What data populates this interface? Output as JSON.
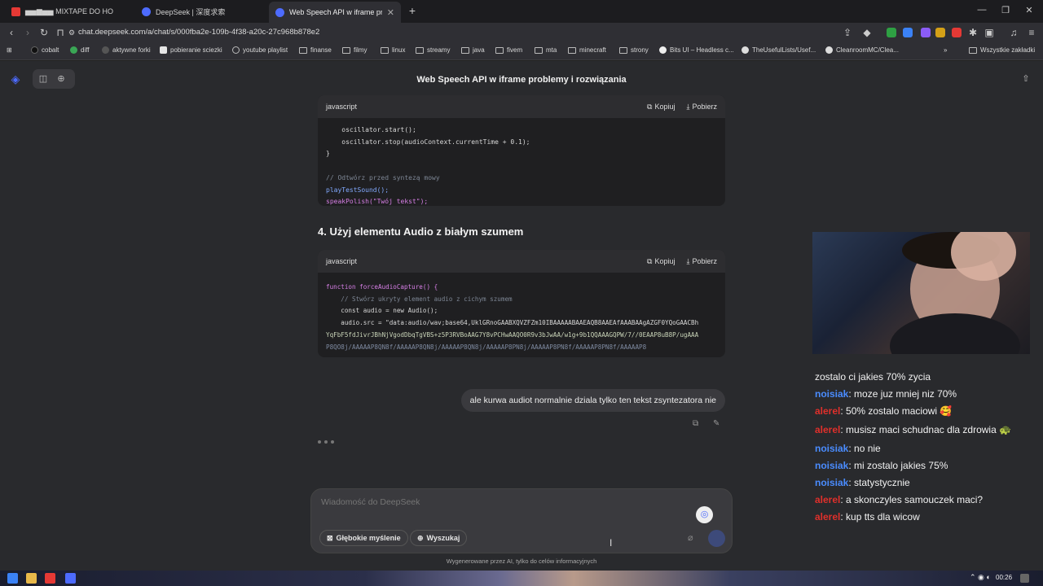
{
  "tabs": [
    {
      "label": "▅▅▆▅▅ MIXTAPE DO HO",
      "favicon_color": "#e53935"
    },
    {
      "label": "DeepSeek | 深度求索",
      "favicon_color": "#4d6bfe"
    },
    {
      "label": "Web Speech API w iframe proble",
      "favicon_color": "#4d6bfe",
      "active": true
    }
  ],
  "address_bar": {
    "url": "chat.deepseek.com/a/chat/s/000fba2e-109b-4f38-a20c-27c968b878e2"
  },
  "bookmarks": [
    {
      "label": "cobalt",
      "icon": "cobalt-icon"
    },
    {
      "label": "diff",
      "icon": "diff-icon"
    },
    {
      "label": "aktywne forki",
      "icon": "fork-icon"
    },
    {
      "label": "pobieranie sciezki",
      "icon": "download-icon"
    },
    {
      "label": "youtube playlist",
      "icon": "globe-icon"
    },
    {
      "label": "finanse",
      "icon": "folder-icon"
    },
    {
      "label": "filmy",
      "icon": "folder-icon"
    },
    {
      "label": "linux",
      "icon": "folder-icon"
    },
    {
      "label": "streamy",
      "icon": "folder-icon"
    },
    {
      "label": "java",
      "icon": "folder-icon"
    },
    {
      "label": "fivem",
      "icon": "folder-icon"
    },
    {
      "label": "mta",
      "icon": "folder-icon"
    },
    {
      "label": "minecraft",
      "icon": "folder-icon"
    },
    {
      "label": "strony",
      "icon": "folder-icon"
    },
    {
      "label": "Bits UI – Headless c...",
      "icon": "circle-icon"
    },
    {
      "label": "TheUsefulLists/Usef...",
      "icon": "github-icon"
    },
    {
      "label": "CleanroomMC/Clea...",
      "icon": "github-icon"
    },
    {
      "label": "Wszystkie zakładki",
      "icon": "folder-icon"
    }
  ],
  "chat": {
    "title": "Web Speech API w iframe problemy i rozwiązania",
    "code_actions": {
      "copy": "Kopiuj",
      "download": "Pobierz"
    },
    "block1": {
      "lang": "javascript",
      "lines": [
        "    oscillator.start();",
        "    oscillator.stop(audioContext.currentTime + 0.1);",
        "}",
        "",
        "// Odtwórz przed syntezą mowy",
        "playTestSound();",
        "speakPolish(\"Twój tekst\");"
      ]
    },
    "section4": "4. Użyj elementu Audio z białym szumem",
    "block2": {
      "lang": "javascript",
      "lines": [
        "function forceAudioCapture() {",
        "    // Stwórz ukryty element audio z cichym szumem",
        "    const audio = new Audio();",
        "    audio.src = \"data:audio/wav;base64,UklGRnoGAABXQVZFZm10IBAAAAABAAEAQB8AAEAfAAABAAgAZGF0YQoGAACBh",
        "YqFbF5fdJivrJBhNjVgodDbqTgVBS+z5P3RVBoAAG7Y8vPCHwAAQO0R9v3bJwAA/w1g+9b1QQAAAGQPW/7//0EAAP8uB8P/ugAAA",
        "P8QO8j/AAAAAP8QN8f/AAAAAP8QN8j/AAAAAP8QN8j/AAAAAP8PN8j/AAAAAP8PN8f/AAAAAP8PN8f/AAAAAP8"
      ]
    },
    "user_message": "ale kurwa audiot normalnie dziala tylko ten tekst zsyntezatora nie",
    "composer_placeholder": "Wiadomość do DeepSeek",
    "deep_think_label": "Głębokie myślenie",
    "search_label": "Wyszukaj",
    "footer_note": "Wygenerowane przez AI, tylko do celów informacyjnych"
  },
  "stream_chat": [
    {
      "nick": "",
      "text": "zostalo ci jakies 70% zycia",
      "color": "#f2f2f2"
    },
    {
      "nick": "noisiak",
      "text": ": moze juz mniej niz 70%",
      "color": "#4a8cff"
    },
    {
      "nick": "alerel",
      "text": ": 50% zostalo maciowi 🥰",
      "color": "#e0302b"
    },
    {
      "nick": "alerel",
      "text": ": musisz maci schudnac dla zdrowia 🐢",
      "color": "#e0302b"
    },
    {
      "nick": "noisiak",
      "text": ": no nie",
      "color": "#4a8cff"
    },
    {
      "nick": "noisiak",
      "text": ": mi zostalo jakies 75%",
      "color": "#4a8cff"
    },
    {
      "nick": "noisiak",
      "text": ": statystycznie",
      "color": "#4a8cff"
    },
    {
      "nick": "alerel",
      "text": ": a skonczyles samouczek maci?",
      "color": "#e0302b"
    },
    {
      "nick": "alerel",
      "text": ": kup tts dla wicow",
      "color": "#e0302b"
    }
  ],
  "taskbar": {
    "clock": "00:26"
  },
  "colors": {
    "accent": "#4d6bfe",
    "bg": "#292a2d",
    "code_bg": "#1f1f21"
  }
}
